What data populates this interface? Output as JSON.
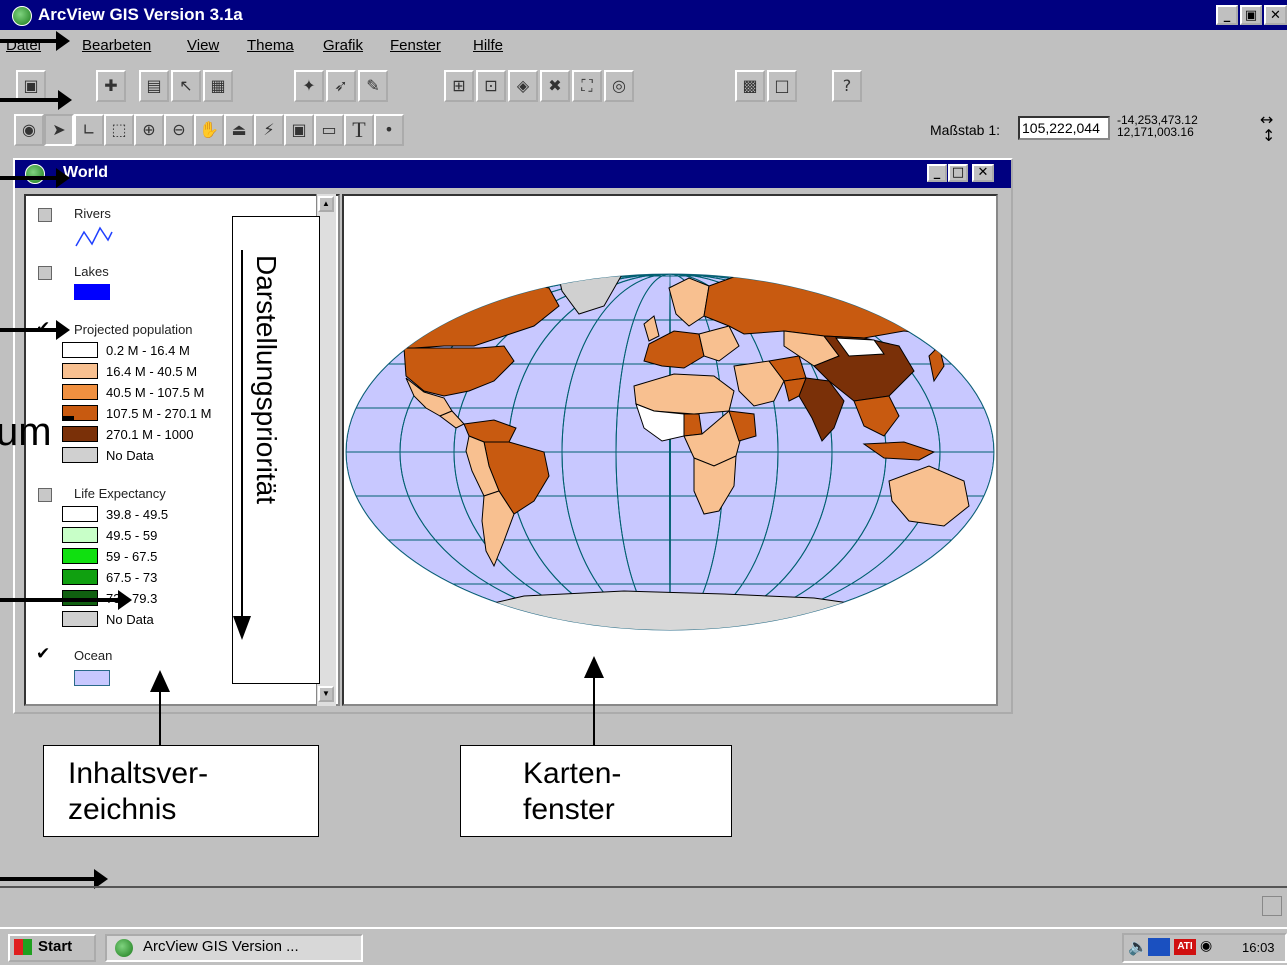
{
  "app": {
    "title": "ArcView GIS Version 3.1a",
    "window_controls": [
      "_",
      "▣",
      "✕"
    ]
  },
  "menu": [
    "Datei",
    "Bearbeten",
    "View",
    "Thema",
    "Grafik",
    "Fenster",
    "Hilfe"
  ],
  "scale": {
    "label": "Maßstab 1:",
    "value": "105,222,044",
    "coord_x": "-14,253,473.12",
    "coord_y": "12,171,003.16"
  },
  "view": {
    "title": "World",
    "controls": [
      "_",
      "□",
      "✕"
    ]
  },
  "toc": {
    "themes": [
      {
        "name": "Rivers",
        "checked": false
      },
      {
        "name": "Lakes",
        "checked": false,
        "color": "#0000ff"
      },
      {
        "name": "Projected population",
        "checked": true,
        "classes": [
          {
            "label": "0.2 M - 16.4 M",
            "color": "#ffffff"
          },
          {
            "label": "16.4 M - 40.5 M",
            "color": "#f8c090"
          },
          {
            "label": "40.5 M - 107.5 M",
            "color": "#f09040"
          },
          {
            "label": "107.5 M - 270.1 M",
            "color": "#c85a10"
          },
          {
            "label": "270.1 M - 1000",
            "color": "#7a3008"
          },
          {
            "label": "No Data",
            "color": "#d0d0d0"
          }
        ]
      },
      {
        "name": "Life Expectancy",
        "checked": false,
        "classes": [
          {
            "label": "39.8 - 49.5",
            "color": "#ffffff"
          },
          {
            "label": "49.5 - 59",
            "color": "#c8ffc8"
          },
          {
            "label": "59 - 67.5",
            "color": "#10e010"
          },
          {
            "label": "67.5 - 73",
            "color": "#10a010"
          },
          {
            "label": "73 - 79.3",
            "color": "#106010"
          },
          {
            "label": "No Data",
            "color": "#d0d0d0"
          }
        ]
      },
      {
        "name": "Ocean",
        "checked": true,
        "color": "#c8c8ff"
      }
    ]
  },
  "annotations": {
    "vertical": "Darstellungspriorität",
    "toc_box": "Inhaltsver-\nzeichnis",
    "map_box": "Karten-\nfenster",
    "left_fragment": "um"
  },
  "taskbar": {
    "start": "Start",
    "item": "ArcView GIS Version ...",
    "clock": "16:03"
  },
  "colors": {
    "ocean": "#c8c8ff",
    "antarctica": "#d8d8d8",
    "grid": "#006070"
  }
}
